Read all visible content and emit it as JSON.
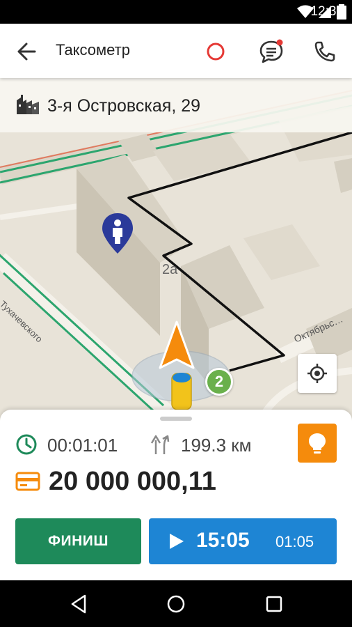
{
  "status_bar": {
    "time": "12:30",
    "icons": [
      "wifi-icon",
      "signal-icon",
      "battery-icon"
    ]
  },
  "app_bar": {
    "title": "Таксометр",
    "actions": [
      "record-icon",
      "chat-icon",
      "phone-icon"
    ]
  },
  "address": {
    "text": "3-я Островская, 29",
    "icon": "building-icon"
  },
  "map": {
    "labels": {
      "building": "2а",
      "street_left": "…а Тухачевского",
      "street_right": "Октябрьс…",
      "waypoint": "2"
    }
  },
  "trip": {
    "duration": "00:01:01",
    "distance": "199.3 км",
    "price": "20 000 000,11"
  },
  "buttons": {
    "finish": "ФИНИШ",
    "timer_main": "15:05",
    "timer_sub": "01:05"
  },
  "colors": {
    "accent_green": "#1e8a5a",
    "accent_blue": "#1e85d4",
    "accent_orange": "#f58b0c",
    "record_red": "#e53935",
    "route": "#111111"
  }
}
